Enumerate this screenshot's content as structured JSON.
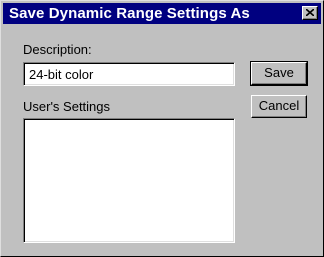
{
  "window": {
    "title": "Save Dynamic Range Settings As",
    "close_icon": "close-icon"
  },
  "form": {
    "description_label": "Description:",
    "description_value": "24-bit color",
    "settings_label": "User's Settings",
    "settings_items": []
  },
  "buttons": {
    "save_label": "Save",
    "cancel_label": "Cancel"
  }
}
